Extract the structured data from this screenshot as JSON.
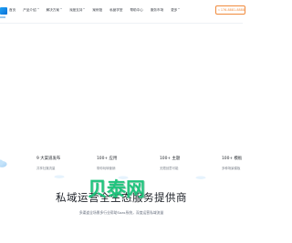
{
  "nav": {
    "items": [
      {
        "label": "首页",
        "caret": false
      },
      {
        "label": "产品介绍",
        "caret": true
      },
      {
        "label": "解决方案",
        "caret": true
      },
      {
        "label": "深度支持",
        "caret": true
      },
      {
        "label": "案例馆",
        "caret": false
      },
      {
        "label": "私营学堂",
        "caret": false
      },
      {
        "label": "帮助中心",
        "caret": false
      },
      {
        "label": "服务市场",
        "caret": false
      },
      {
        "label": "更多",
        "caret": true
      }
    ],
    "phone": "176-8881-8888"
  },
  "cards": [
    {
      "title": "9 大渠道发布",
      "desc": "共享社媒流量"
    },
    {
      "title": "100+ 应用",
      "desc": "带你玩转营销"
    },
    {
      "title": "100+ 主题",
      "desc": "无限创意可能"
    },
    {
      "title": "100+ 模板",
      "desc": "多种场景模板"
    }
  ],
  "section": {
    "title": "私域运营全生态服务提供商",
    "desc": "多渠道全场景多行业帮助Saas系统，深度运营私域流量"
  },
  "watermark": {
    "text": "贝泰网"
  },
  "colors": {
    "accent": "#1a8cf0",
    "phone": "#f08a3c",
    "watermark": "#19c37a"
  }
}
